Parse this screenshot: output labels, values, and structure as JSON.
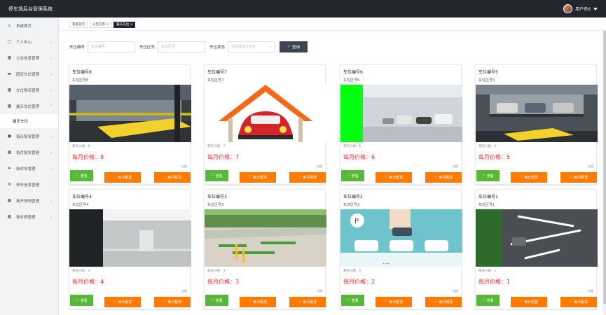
{
  "app": {
    "title": "停车场后台管理系统",
    "user": "用户名6"
  },
  "sidebar": {
    "items": [
      {
        "label": "系统首页",
        "icon": "home-icon",
        "arrow": ""
      },
      {
        "label": "个人中心",
        "icon": "user-icon",
        "arrow": "⌄"
      },
      {
        "label": "公告信息管理",
        "icon": "grid-icon",
        "arrow": "⌄"
      },
      {
        "label": "固定车位管理",
        "icon": "car-icon",
        "arrow": "⌄"
      },
      {
        "label": "车位购买管理",
        "icon": "grid-icon",
        "arrow": "⌄"
      },
      {
        "label": "露天车位管理",
        "icon": "grid-icon",
        "arrow": "⌃"
      }
    ],
    "sub_item": "露天车位",
    "items_after": [
      {
        "label": "每日租赁管理",
        "icon": "pin-icon",
        "arrow": "⌄"
      },
      {
        "label": "每月租赁管理",
        "icon": "grid-icon",
        "arrow": "⌄"
      },
      {
        "label": "临时车管理",
        "icon": "send-icon",
        "arrow": "⌄"
      },
      {
        "label": "停车信息管理",
        "icon": "gear-icon",
        "arrow": "⌄"
      },
      {
        "label": "离开场地管理",
        "icon": "grid-icon",
        "arrow": "⌄"
      },
      {
        "label": "物业费管理",
        "icon": "grid-icon",
        "arrow": "⌄"
      }
    ]
  },
  "tabs": [
    {
      "label": "系统首页"
    },
    {
      "label": "公告信息 ×"
    },
    {
      "label": "露天车位 ×"
    }
  ],
  "search": {
    "no_label": "车位编号",
    "no_placeholder": "车位编号",
    "area_label": "车位区号",
    "area_placeholder": "车位区号",
    "status_label": "车位状态",
    "status_placeholder": "请选择车位状态",
    "query_label": "查询"
  },
  "cards": [
    {
      "no": "车位编号8",
      "area": "车位区号8",
      "daily": "每天价格：8",
      "monthly": "每月价格：8",
      "tag": "出租",
      "view": "查看",
      "rent_day": "每日租赁",
      "rent_month": "每月租赁"
    },
    {
      "no": "车位编号7",
      "area": "车位区号7",
      "daily": "每天价格：7",
      "monthly": "每月价格：7",
      "tag": "出租",
      "view": "查看",
      "rent_day": "每日租赁",
      "rent_month": "每月租赁"
    },
    {
      "no": "车位编号6",
      "area": "车位区号6",
      "daily": "每天价格：6",
      "monthly": "每月价格：6",
      "tag": "出租",
      "view": "查看",
      "rent_day": "每日租赁",
      "rent_month": "每月租赁"
    },
    {
      "no": "车位编号5",
      "area": "车位区号5",
      "daily": "每天价格：5",
      "monthly": "每月价格：5",
      "tag": "出租",
      "view": "查看",
      "rent_day": "每日租赁",
      "rent_month": "每月租赁"
    },
    {
      "no": "车位编号4",
      "area": "车位区号4",
      "daily": "每天价格：4",
      "monthly": "每月价格：4",
      "tag": "出租",
      "view": "查看",
      "rent_day": "每日租赁",
      "rent_month": "每月租赁"
    },
    {
      "no": "车位编号3",
      "area": "车位区号3",
      "daily": "每天价格：3",
      "monthly": "每月价格：3",
      "tag": "出租",
      "view": "查看",
      "rent_day": "每日租赁",
      "rent_month": "每月租赁"
    },
    {
      "no": "车位编号2",
      "area": "车位区号2",
      "daily": "每天价格：2",
      "monthly": "每月价格：2",
      "tag": "出租",
      "view": "查看",
      "rent_day": "每日租赁",
      "rent_month": "每月租赁"
    },
    {
      "no": "车位编号1",
      "area": "车位区号1",
      "daily": "每天价格：1",
      "monthly": "每月价格：1",
      "tag": "出租",
      "view": "查看",
      "rent_day": "每日租赁",
      "rent_month": "每月租赁"
    }
  ],
  "colors": {
    "header": "#23262e",
    "view_button": "#58b83a",
    "rent_button": "#ff7a00",
    "price": "#ff2d2d"
  }
}
